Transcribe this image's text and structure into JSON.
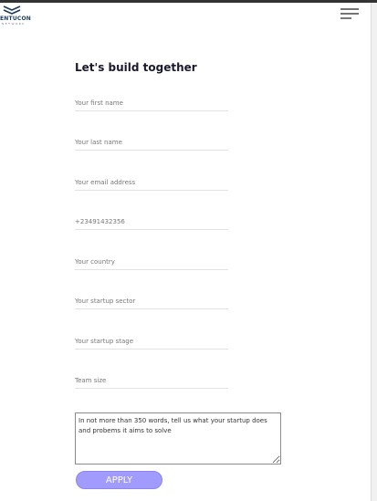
{
  "header": {
    "logo_text": "ENTUCON",
    "logo_subtext": "NETWORK",
    "menu_icon": "hamburger-menu-icon"
  },
  "form": {
    "title": "Let's build together",
    "fields": [
      {
        "name": "first-name",
        "placeholder": "Your first name",
        "value": ""
      },
      {
        "name": "last-name",
        "placeholder": "Your last name",
        "value": ""
      },
      {
        "name": "email",
        "placeholder": "Your email address",
        "value": ""
      },
      {
        "name": "phone",
        "placeholder": "+23491432356",
        "value": ""
      },
      {
        "name": "country",
        "placeholder": "Your country",
        "value": ""
      },
      {
        "name": "startup-sector",
        "placeholder": "Your startup sector",
        "value": ""
      },
      {
        "name": "startup-stage",
        "placeholder": "Your startup stage",
        "value": ""
      },
      {
        "name": "team-size",
        "placeholder": "Team size",
        "value": ""
      }
    ],
    "message_placeholder": "In not more than 350 words, tell us what your startup does and probems it aims to solve",
    "submit_label": "APPLY"
  },
  "colors": {
    "accent": "#a29bfe",
    "title": "#1a1a2e",
    "logo": "#1e3a5f"
  }
}
